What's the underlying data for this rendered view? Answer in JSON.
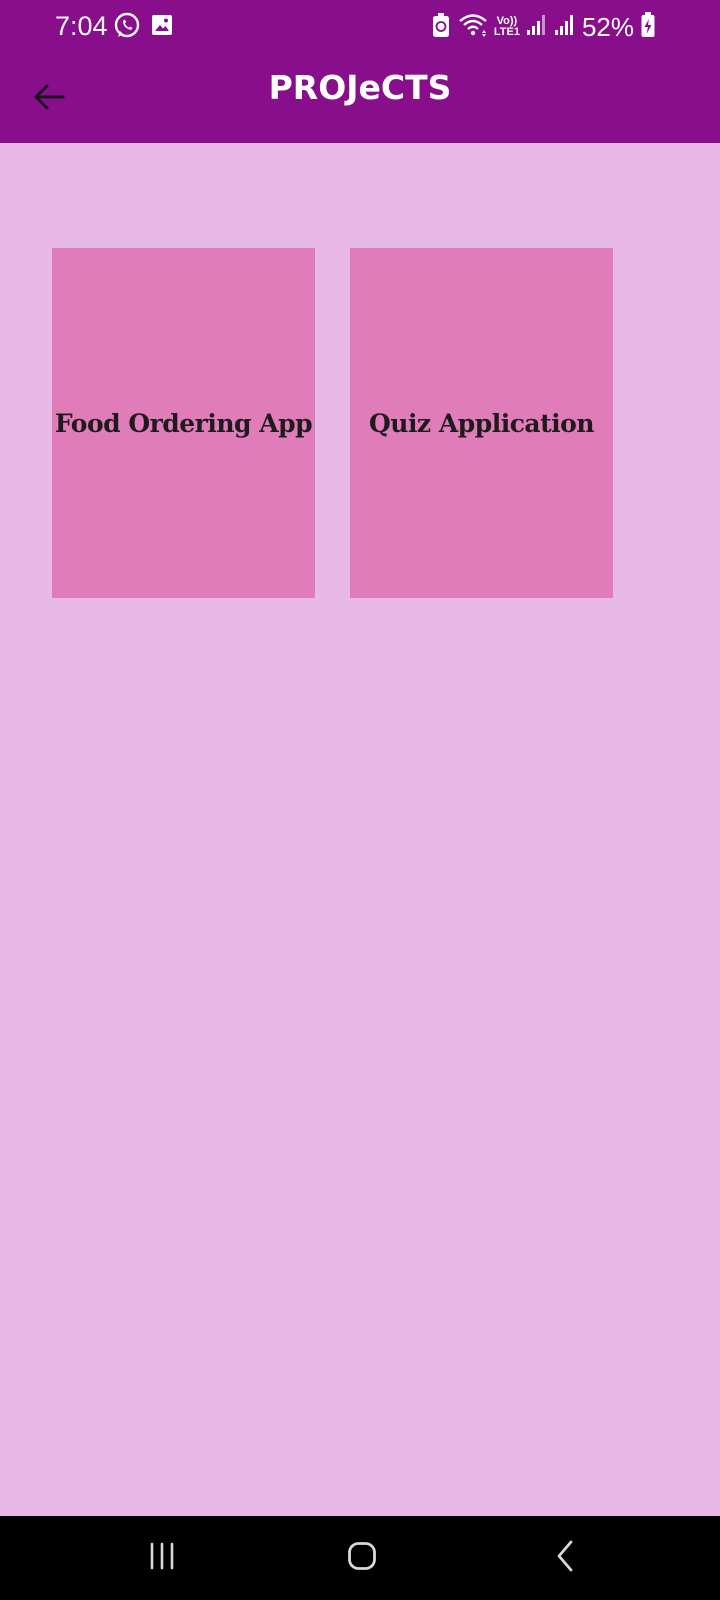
{
  "status_bar": {
    "time": "7:04",
    "battery_percent": "52%",
    "network_top": "Vo))",
    "network_bottom": "LTE1",
    "icons": [
      "whatsapp-icon",
      "gallery-icon",
      "battery-saver-icon",
      "wifi-icon",
      "signal-icon",
      "signal-icon",
      "battery-charging-icon"
    ]
  },
  "app_bar": {
    "title": "PROJeCTS",
    "back_icon": "arrow-left-icon"
  },
  "projects": [
    {
      "label": "Food Ordering App"
    },
    {
      "label": "Quiz Application"
    }
  ],
  "nav_bar": {
    "buttons": [
      "recents-icon",
      "home-icon",
      "back-icon"
    ]
  },
  "colors": {
    "primary": "#880e8c",
    "background": "#e8b8e6",
    "card": "#e07cb9",
    "card_text": "#1f1a1e"
  }
}
